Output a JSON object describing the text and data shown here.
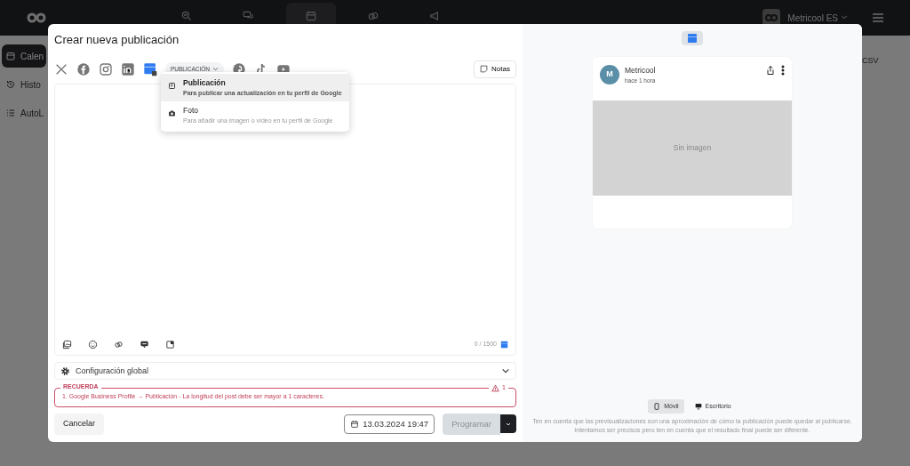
{
  "topbar": {
    "nav": [
      {
        "kind": "analytics",
        "selected": false
      },
      {
        "kind": "chat",
        "selected": false
      },
      {
        "kind": "calendar",
        "selected": true
      },
      {
        "kind": "link",
        "selected": false
      },
      {
        "kind": "megaphone",
        "selected": false
      }
    ],
    "account": "Metricool ES"
  },
  "sidebar": {
    "items": [
      {
        "kind": "calendar",
        "label": "Calen",
        "selected": true
      },
      {
        "kind": "history",
        "label": "Histo",
        "selected": false
      },
      {
        "kind": "list",
        "label": "AutoL",
        "selected": false
      }
    ]
  },
  "toolbar": {
    "export": "CSV"
  },
  "modal": {
    "title": "Crear nueva publicación",
    "networks": [
      {
        "kind": "x",
        "selected": false
      },
      {
        "kind": "facebook",
        "selected": false
      },
      {
        "kind": "instagram",
        "selected": false
      },
      {
        "kind": "linkedin",
        "selected": false
      },
      {
        "kind": "gbp",
        "selected": true
      },
      {
        "kind": "pinterest",
        "selected": false
      },
      {
        "kind": "tiktok",
        "selected": false
      },
      {
        "kind": "youtube",
        "selected": false
      }
    ],
    "type_dropdown": "PUBLICACIÓN",
    "notes": "Notas",
    "menu": [
      {
        "kind": "post",
        "label": "Publicación",
        "description": "Para publicar una actualización en tu perfil de Google",
        "selected": true
      },
      {
        "kind": "photo",
        "label": "Foto",
        "description": "Para añadir una imagen o vídeo en tu perfil de Google",
        "selected": false
      }
    ],
    "counter": "0 / 1500",
    "global_config": "Configuración global",
    "alert": {
      "title": "RECUERDA",
      "count": "1",
      "items": [
        "1. Google Business Profile → Publicación - La longitud del post debe ser mayor a 1 caracteres."
      ]
    },
    "cancel": "Cancelar",
    "date": "13.03.2024 19:47",
    "schedule": "Programar",
    "schedule_disabled": true
  },
  "preview": {
    "avatar": "M",
    "account": "Metricool",
    "time": "hace 1 hora",
    "image_placeholder": "Sin imagen",
    "views": [
      {
        "kind": "mobile",
        "label": "Móvil",
        "selected": true
      },
      {
        "kind": "desktop",
        "label": "Escritorio",
        "selected": false
      }
    ],
    "note": "Ten en cuenta que las previsualizaciones son una aproximación de cómo la publicación puede quedar al publicarse. Intentamos ser precisos pero ten en cuenta que el resultado final puede ser diferente."
  }
}
